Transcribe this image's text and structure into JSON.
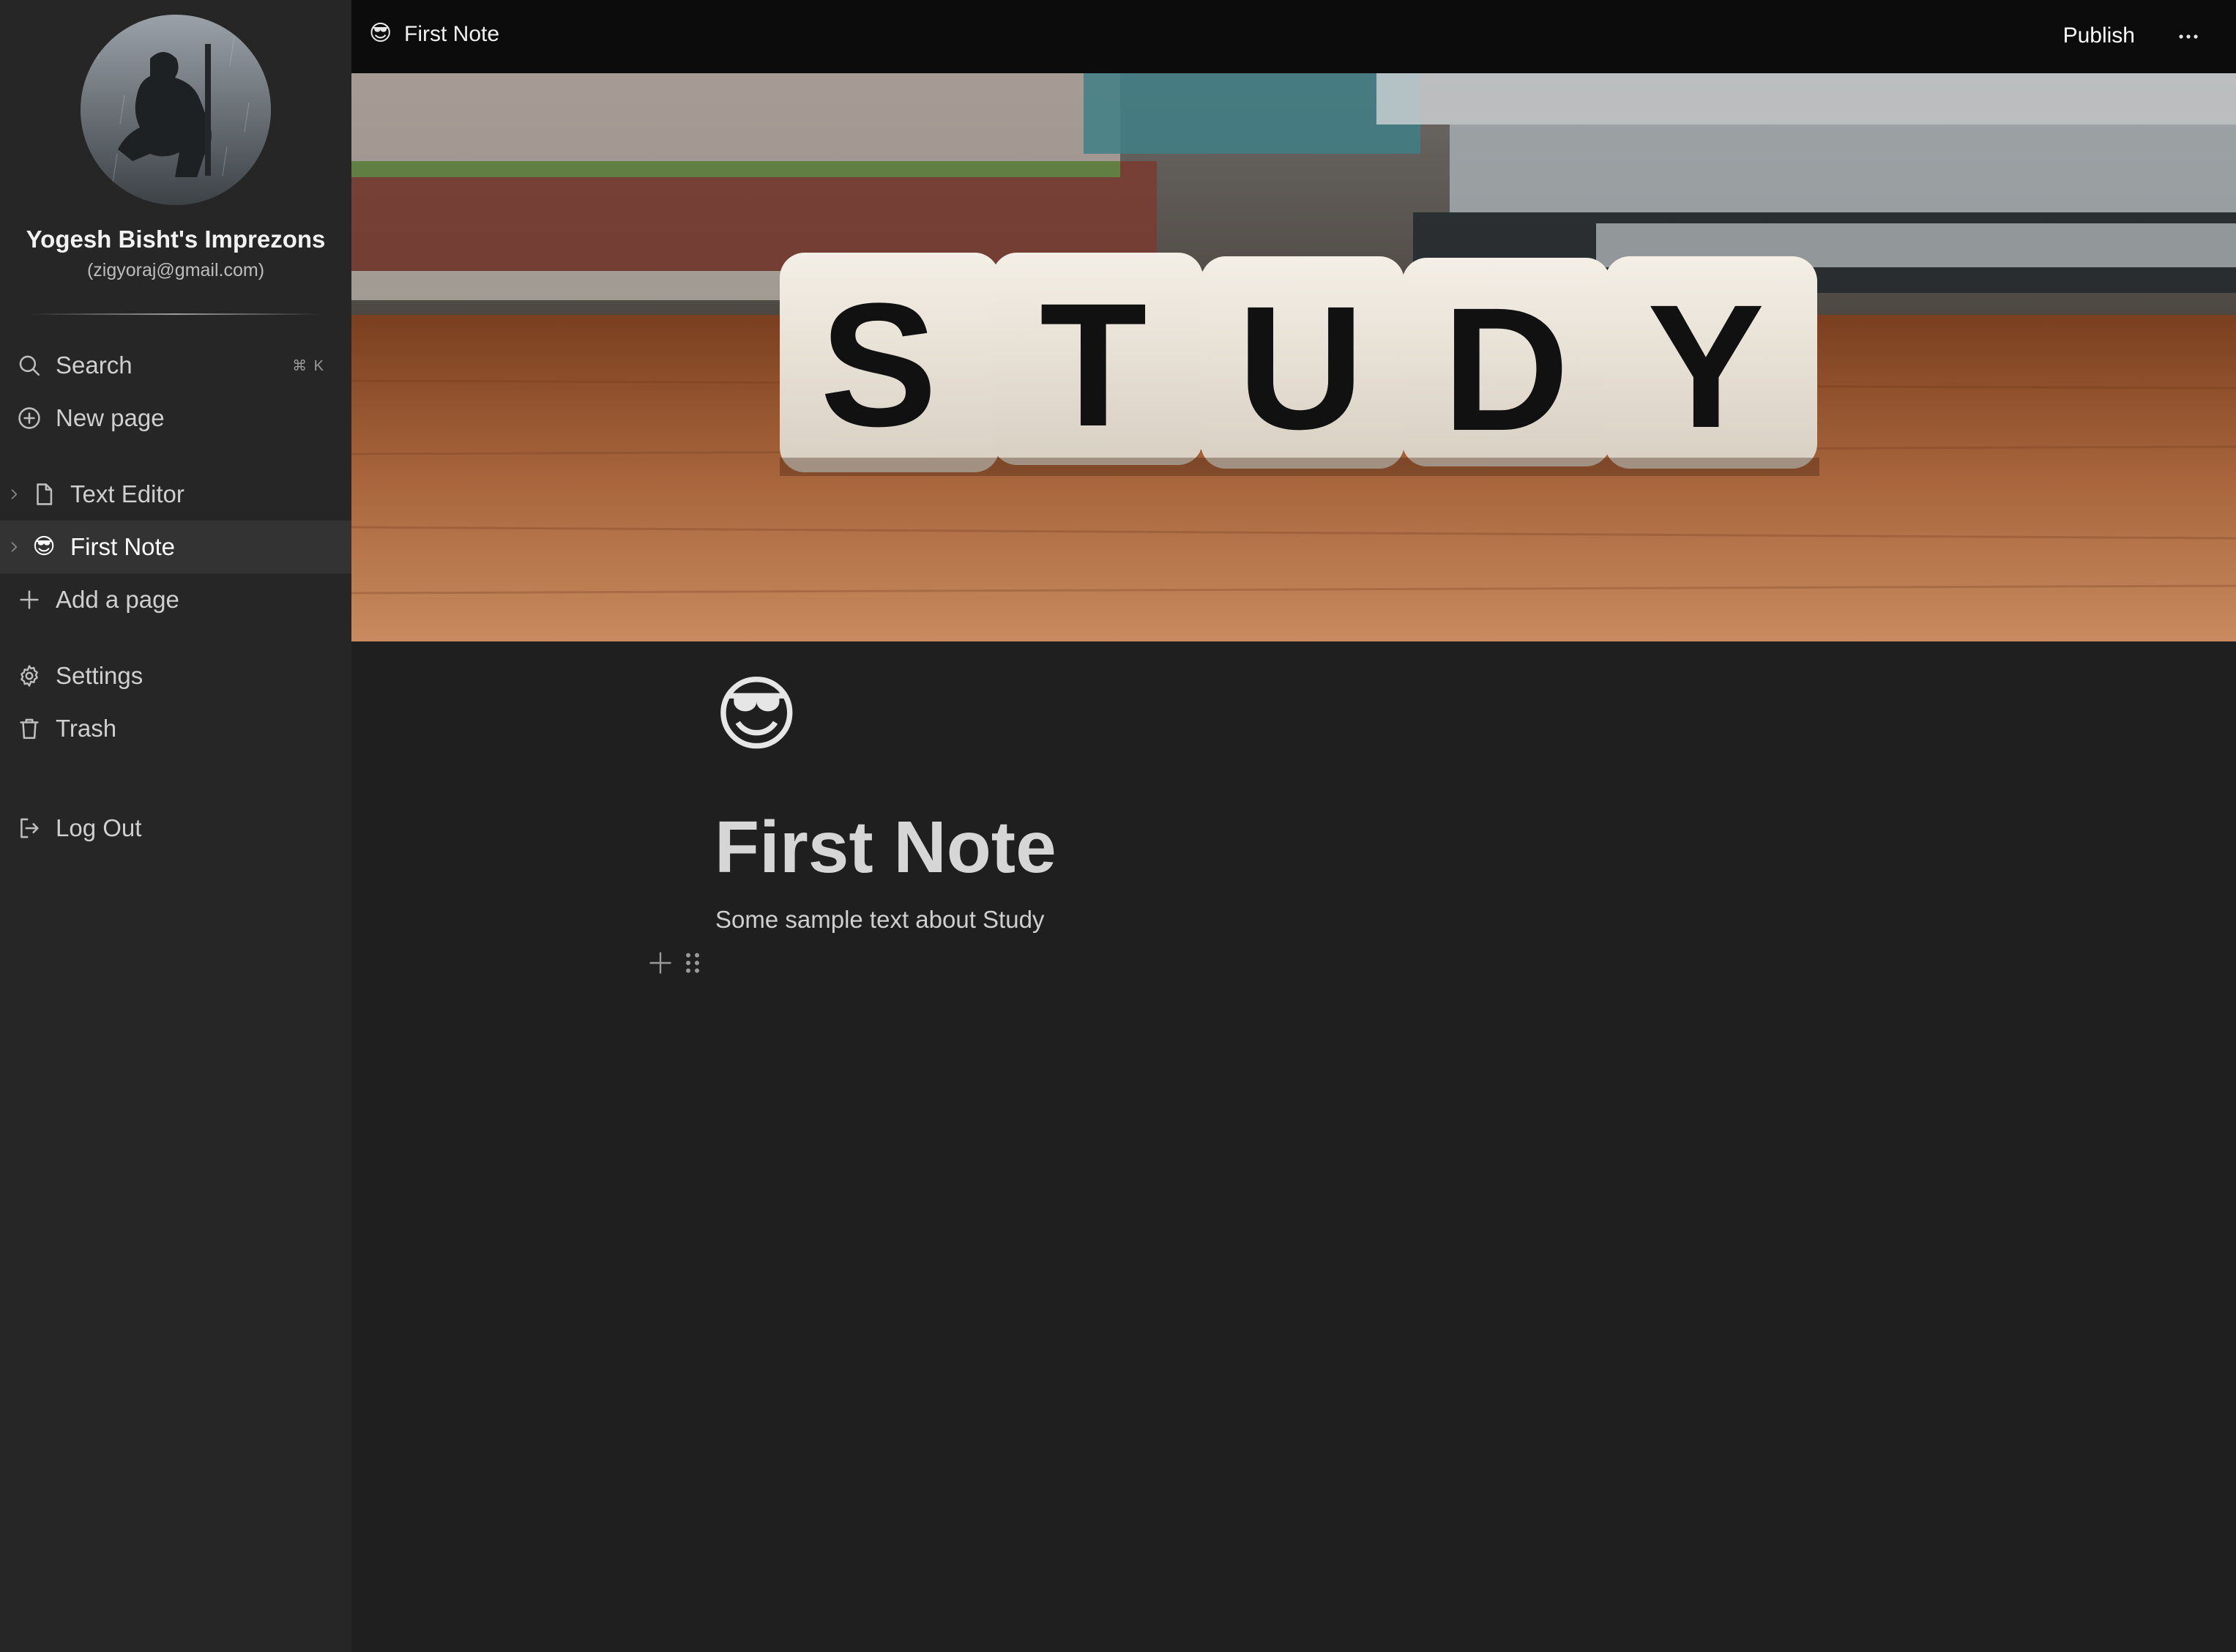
{
  "sidebar": {
    "workspace_name": "Yogesh Bisht's Imprezons",
    "email": "(zigyoraj@gmail.com)",
    "search_label": "Search",
    "search_shortcut": "⌘ K",
    "new_page_label": "New page",
    "pages": [
      {
        "label": "Text Editor",
        "icon": "file-icon"
      },
      {
        "label": "First Note",
        "icon": "😎"
      }
    ],
    "add_page_label": "Add a page",
    "settings_label": "Settings",
    "trash_label": "Trash",
    "logout_label": "Log Out"
  },
  "topbar": {
    "page_emoji": "😎",
    "page_title": "First Note",
    "publish_label": "Publish"
  },
  "cover": {
    "letters": [
      "S",
      "T",
      "U",
      "D",
      "Y"
    ]
  },
  "document": {
    "icon": "😎",
    "title": "First Note",
    "body": "Some sample text about Study"
  },
  "colors": {
    "background": "#1f1f1f",
    "sidebar": "#262626",
    "topbar": "#0c0c0c",
    "active_item": "#333333"
  }
}
